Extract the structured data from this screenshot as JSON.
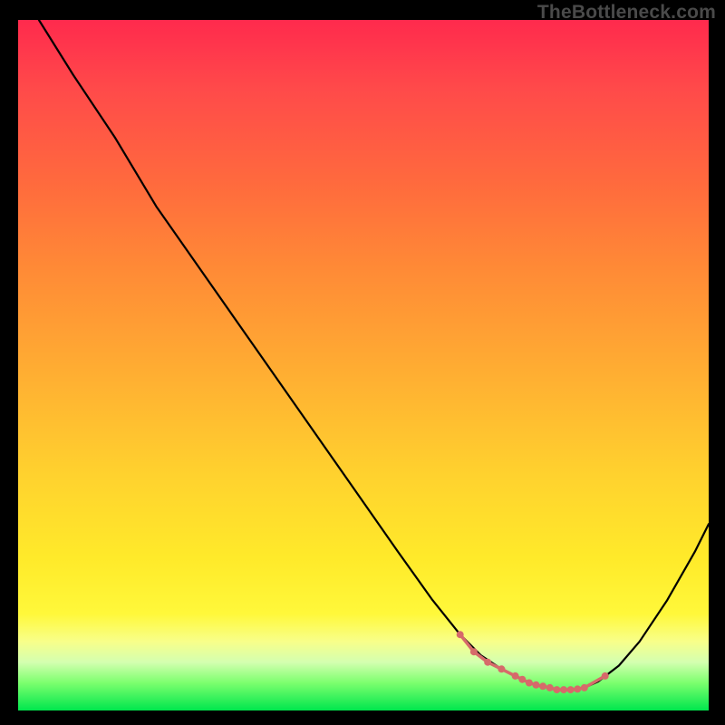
{
  "watermark": "TheBottleneck.com",
  "chart_data": {
    "type": "line",
    "title": "",
    "xlabel": "",
    "ylabel": "",
    "xlim": [
      0,
      100
    ],
    "ylim": [
      0,
      100
    ],
    "grid": false,
    "legend": false,
    "series": [
      {
        "name": "bottleneck-curve",
        "x": [
          3,
          8,
          14,
          20,
          27,
          34,
          41,
          48,
          55,
          60,
          64,
          67,
          70,
          72,
          74,
          76,
          78,
          80,
          82,
          84,
          87,
          90,
          94,
          98,
          100
        ],
        "y": [
          100,
          92,
          83,
          73,
          63,
          53,
          43,
          33,
          23,
          16,
          11,
          8,
          6,
          5,
          4,
          3.5,
          3,
          3,
          3.3,
          4.2,
          6.5,
          10,
          16,
          23,
          27
        ]
      }
    ],
    "markers": {
      "name": "optimal-range",
      "x": [
        64,
        66,
        68,
        70,
        72,
        73,
        74,
        75,
        76,
        77,
        78,
        79,
        80,
        81,
        82,
        85
      ],
      "y": [
        11,
        8.5,
        7,
        6,
        5,
        4.5,
        4,
        3.7,
        3.5,
        3.3,
        3,
        3,
        3,
        3.1,
        3.3,
        5
      ]
    }
  }
}
